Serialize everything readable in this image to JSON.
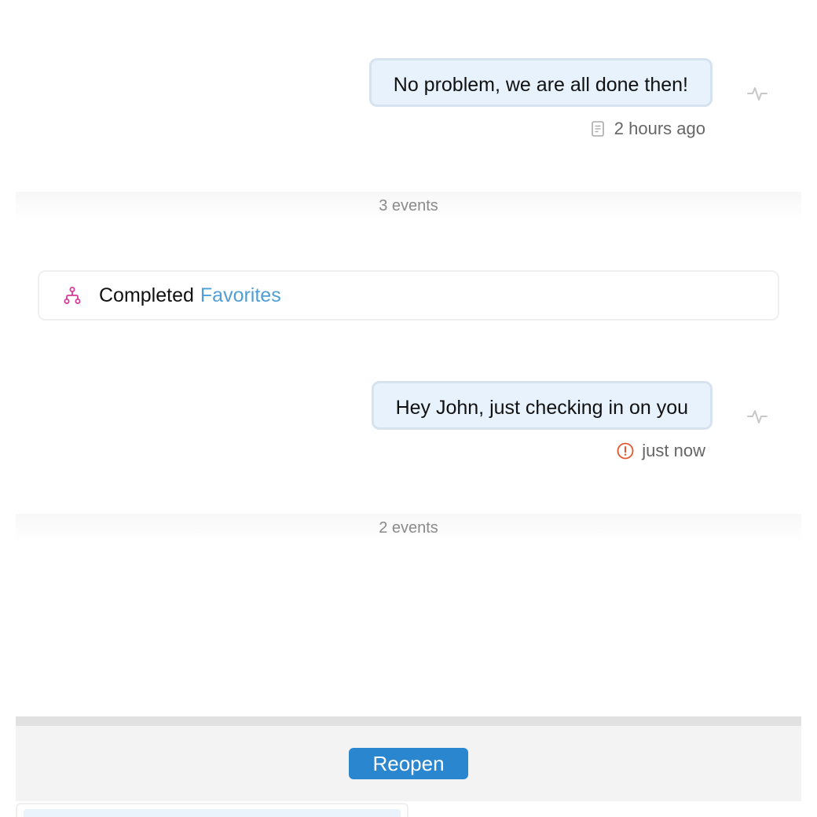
{
  "messages": [
    {
      "text": "No problem, we are all done then!",
      "status_icon": "note-icon",
      "time": "2 hours ago"
    },
    {
      "text": "Hey John, just checking in on you",
      "status_icon": "alert-circle-icon",
      "time": "just now"
    }
  ],
  "separators": [
    {
      "label": "3 events"
    },
    {
      "label": "2 events"
    }
  ],
  "event": {
    "icon": "flow-icon",
    "action": "Completed",
    "target": "Favorites"
  },
  "footer": {
    "reopen_label": "Reopen"
  },
  "colors": {
    "bubble_bg": "#e7f2fd",
    "bubble_border": "#d6e3ef",
    "link": "#4f9ed6",
    "event_icon": "#d63a9c",
    "alert": "#e4572e",
    "button": "#2a86cf"
  }
}
